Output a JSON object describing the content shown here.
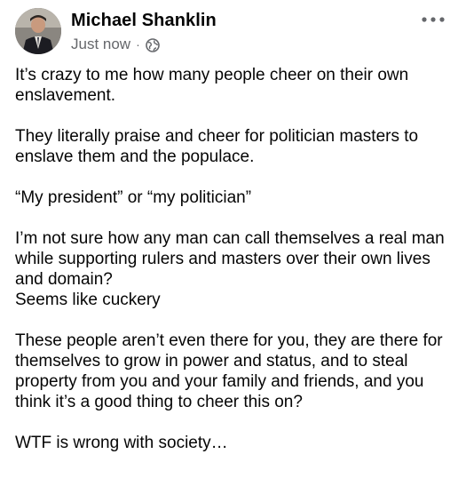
{
  "post": {
    "author_name": "Michael Shanklin",
    "timestamp": "Just now",
    "separator": "·",
    "privacy_icon": "globe-icon",
    "more_icon": "more-horizontal-icon",
    "paragraphs": [
      "It’s crazy to me how many people cheer on their own enslavement.",
      "They literally praise and cheer for politician masters to enslave them and the populace.",
      "“My president” or “my politician”",
      "I’m not sure how any man can call themselves a real man while supporting rulers and masters over their own lives and domain?",
      "Seems like cuckery",
      "These people aren’t even there for you, they are there for themselves to grow in power and status, and to steal property from you and your family and friends, and you think it’s a good thing to cheer this on?",
      "WTF is wrong with society…"
    ]
  },
  "colors": {
    "text_primary": "#050505",
    "text_secondary": "#65676b"
  }
}
